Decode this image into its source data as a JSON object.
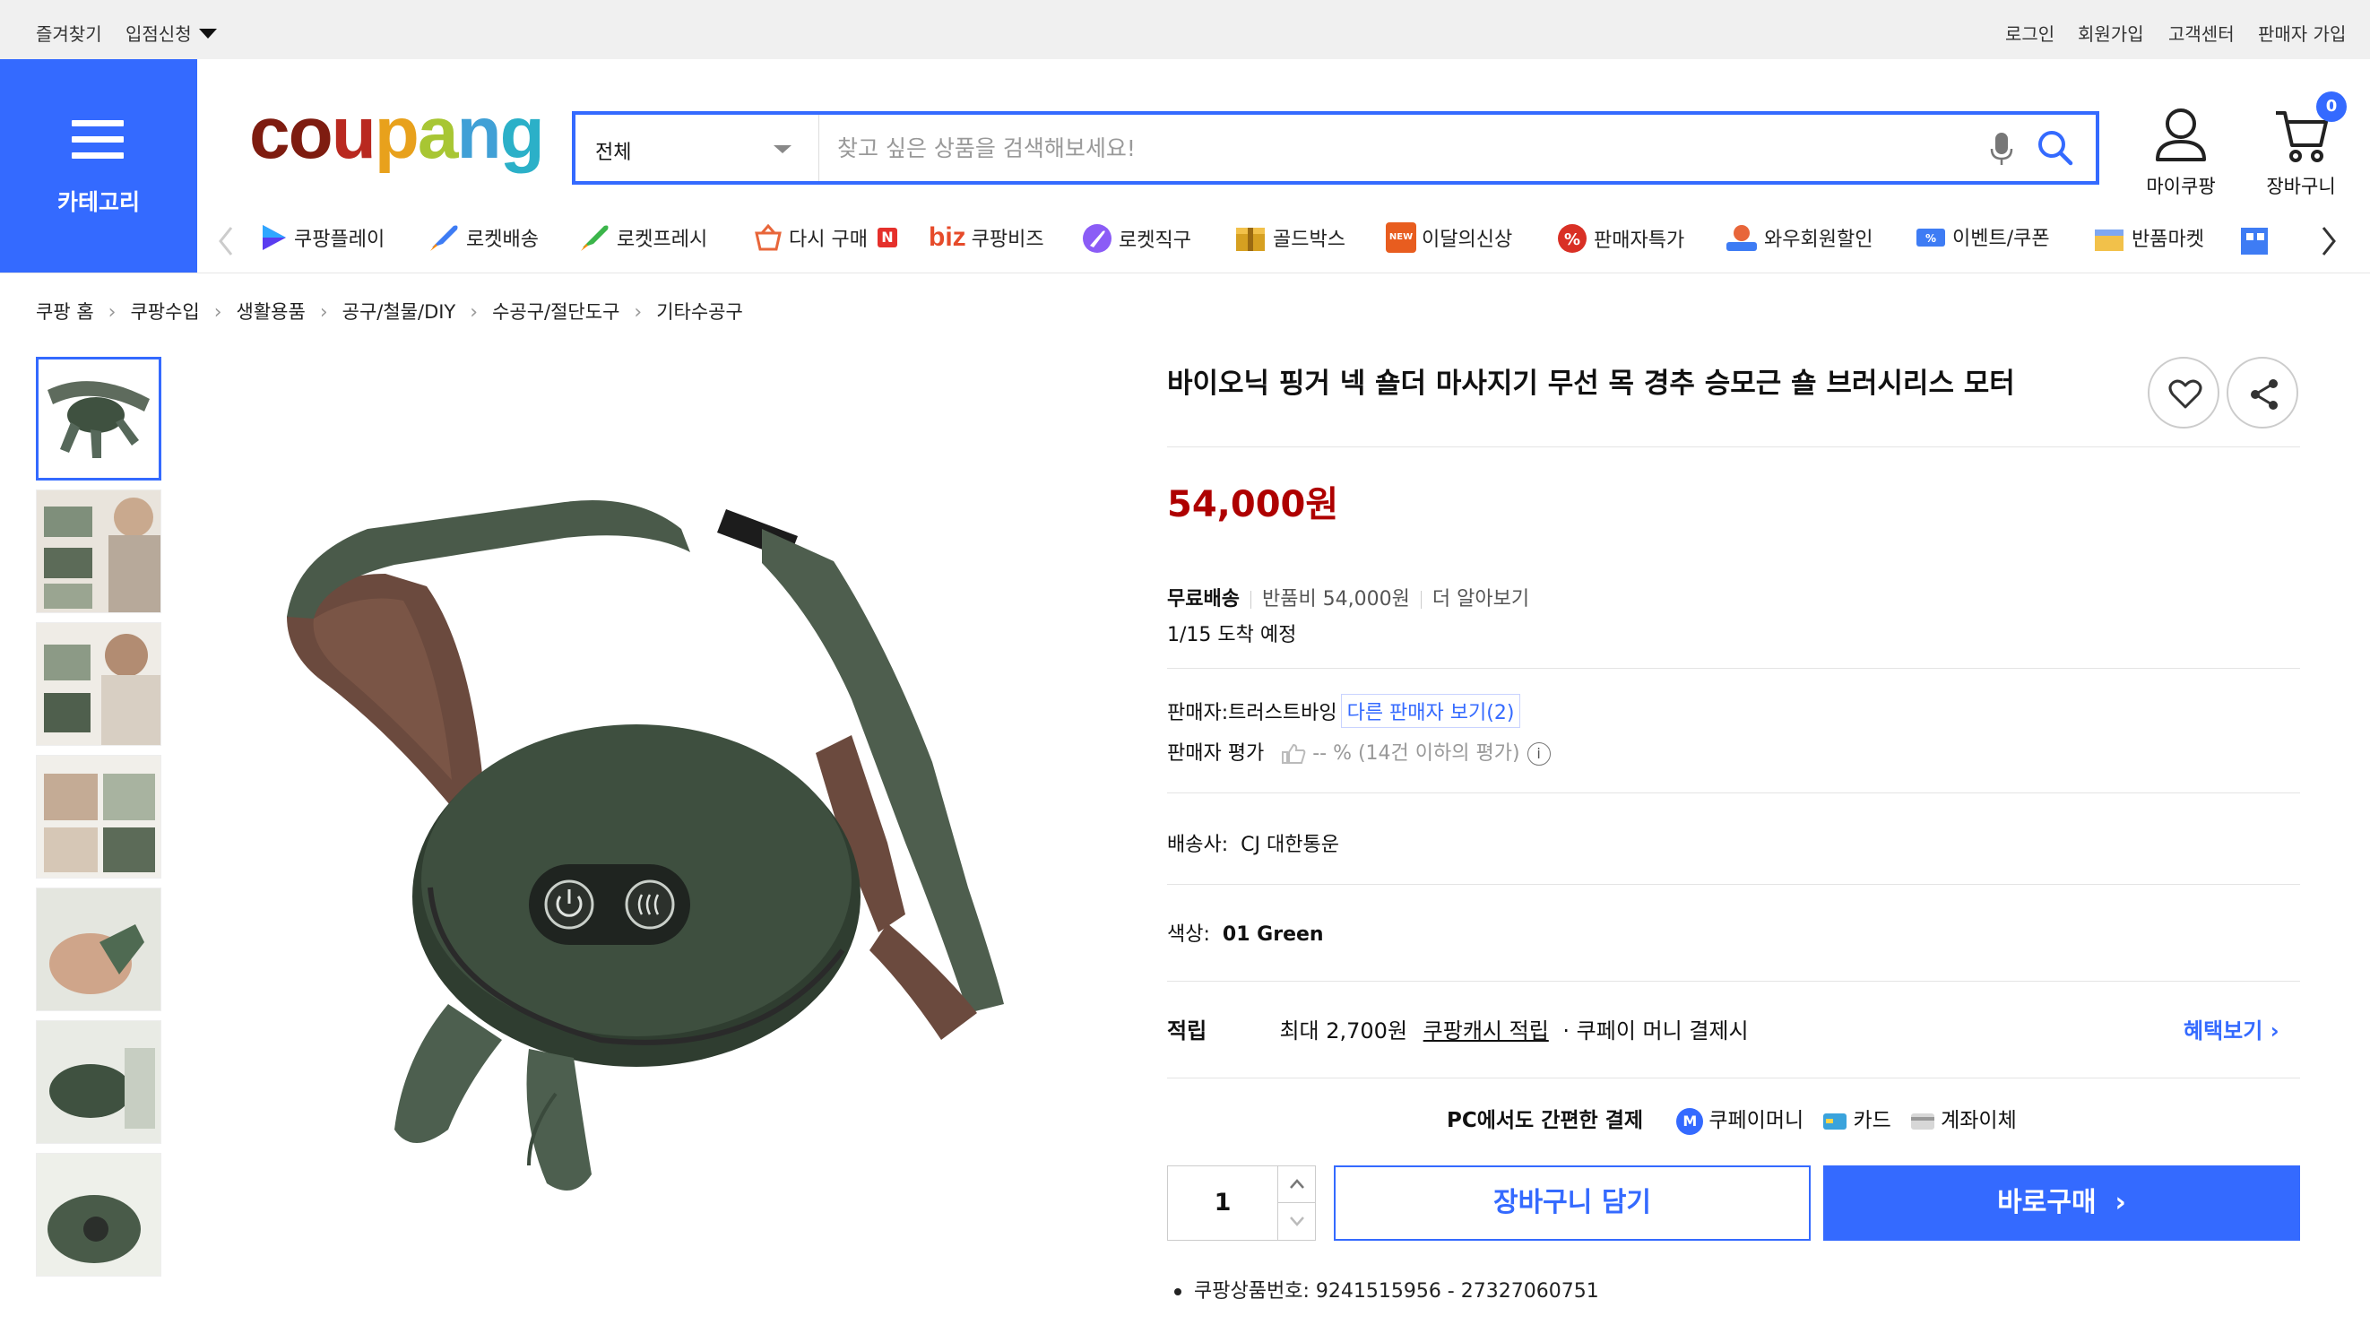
{
  "topbar": {
    "left": [
      "즐겨찾기",
      "입점신청"
    ],
    "right": [
      "로그인",
      "회원가입",
      "고객센터",
      "판매자 가입"
    ]
  },
  "header": {
    "category_label": "카테고리",
    "logo_letters": [
      "c",
      "o",
      "u",
      "p",
      "a",
      "n",
      "g"
    ],
    "logo_colors": [
      "#7e1c10",
      "#7e1c10",
      "#b92920",
      "#e8a11c",
      "#a8c633",
      "#40a0d6",
      "#2bb0c8"
    ],
    "search_scope": "전체",
    "search_placeholder": "찾고 싶은 상품을 검색해보세요!",
    "mycoupang_label": "마이쿠팡",
    "cart_label": "장바구니",
    "cart_count": "0",
    "accent": "#346aff"
  },
  "nav": {
    "items": [
      "쿠팡플레이",
      "로켓배송",
      "로켓프레시",
      "다시 구매",
      "쿠팡비즈",
      "로켓직구",
      "골드박스",
      "이달의신상",
      "판매자특가",
      "와우회원할인",
      "이벤트/쿠폰",
      "반품마켓"
    ],
    "reorder_badge": "N",
    "biz_prefix": "biz",
    "new_badge": "NEW"
  },
  "breadcrumb": [
    "쿠팡 홈",
    "쿠팡수입",
    "생활용품",
    "공구/철물/DIY",
    "수공구/절단도구",
    "기타수공구"
  ],
  "product": {
    "title": "바이오닉 핑거 넥 숄더 마사지기 무선 목 경추 승모근 숄 브러시리스 모터",
    "price": "54,000원",
    "price_color": "#ae0000",
    "shipping": "무료배송",
    "return_fee": "반품비 54,000원",
    "learn_more": "더 알아보기",
    "arrival": "1/15 도착 예정",
    "seller": "판매자:트러스트바잉",
    "other_sellers": "다른 판매자 보기(2)",
    "seller_rating_label": "판매자 평가",
    "seller_rating_value": "-- % (14건 이하의 평가)",
    "courier_label": "배송사:",
    "courier": "CJ 대한통운",
    "color_label": "색상:",
    "color": "01 Green",
    "points_label": "적립",
    "points_max": "최대 2,700원",
    "points_cash": "쿠팡캐시 적립",
    "points_note": "· 쿠페이 머니 결제시",
    "benefits_link": "혜택보기",
    "pay_headline": "PC에서도 간편한 결제",
    "pay_methods": [
      "쿠페이머니",
      "카드",
      "계좌이체"
    ],
    "pay_money_icon": "M",
    "quantity": "1",
    "add_to_cart": "장바구니 담기",
    "buy_now": "바로구매",
    "product_number": "쿠팡상품번호: 9241515956 - 27327060751"
  }
}
